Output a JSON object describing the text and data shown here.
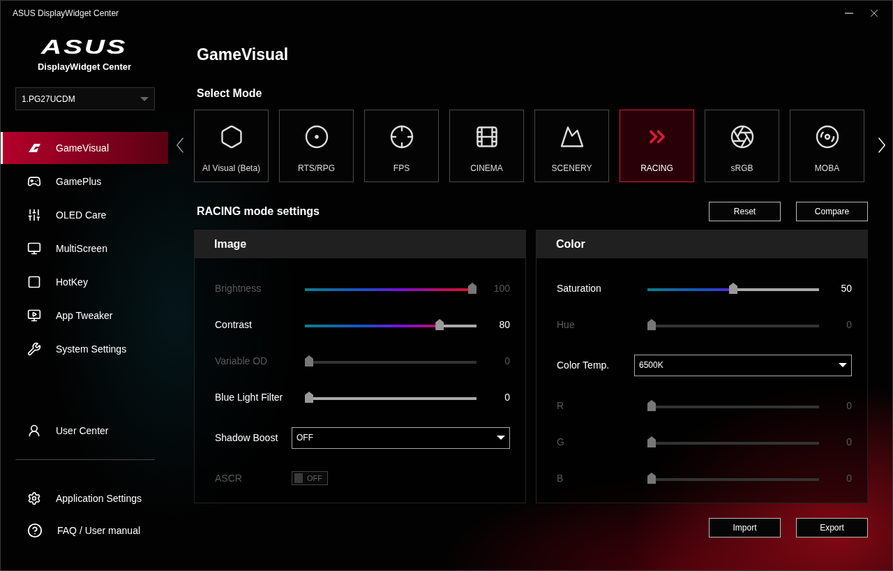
{
  "window": {
    "title": "ASUS DisplayWidget Center"
  },
  "brand": {
    "logo": "ASUS",
    "product": "DisplayWidget Center"
  },
  "monitor_select": {
    "value": "1.PG27UCDM"
  },
  "nav": [
    {
      "label": "GameVisual",
      "selected": true
    },
    {
      "label": "GamePlus",
      "selected": false
    },
    {
      "label": "OLED Care",
      "selected": false
    },
    {
      "label": "MultiScreen",
      "selected": false
    },
    {
      "label": "HotKey",
      "selected": false
    },
    {
      "label": "App Tweaker",
      "selected": false
    },
    {
      "label": "System Settings",
      "selected": false
    }
  ],
  "user_center": {
    "label": "User Center"
  },
  "footer_nav": [
    {
      "label": "Application Settings"
    },
    {
      "label": "FAQ / User manual"
    }
  ],
  "page_title": "GameVisual",
  "mode_heading": "Select Mode",
  "modes": [
    {
      "label": "AI Visual (Beta)",
      "selected": false
    },
    {
      "label": "RTS/RPG",
      "selected": false
    },
    {
      "label": "FPS",
      "selected": false
    },
    {
      "label": "CINEMA",
      "selected": false
    },
    {
      "label": "SCENERY",
      "selected": false
    },
    {
      "label": "RACING",
      "selected": true
    },
    {
      "label": "sRGB",
      "selected": false
    },
    {
      "label": "MOBA",
      "selected": false
    }
  ],
  "settings_title": "RACING mode settings",
  "actions": [
    "Reset",
    "Compare"
  ],
  "panels": [
    {
      "title": "Image",
      "rows": [
        {
          "kind": "slider",
          "label": "Brightness",
          "level": 1,
          "reading": "100",
          "disabled": true
        },
        {
          "kind": "slider",
          "label": "Contrast",
          "level": 0.8,
          "reading": "80",
          "disabled": false
        },
        {
          "kind": "slider",
          "label": "Variable OD",
          "level": 0,
          "reading": "0",
          "disabled": true
        },
        {
          "kind": "slider",
          "label": "Blue Light Filter",
          "level": 0,
          "reading": "0",
          "disabled": false
        },
        {
          "kind": "dropdown",
          "label": "Shadow Boost",
          "value": "OFF"
        },
        {
          "kind": "toggle",
          "label": "ASCR",
          "on": false,
          "disabled": true,
          "state_text": "OFF"
        }
      ]
    },
    {
      "title": "Color",
      "rows": [
        {
          "kind": "slider",
          "label": "Saturation",
          "level": 0.5,
          "reading": "50",
          "disabled": false
        },
        {
          "kind": "slider",
          "label": "Hue",
          "level": 0,
          "reading": "0",
          "disabled": true
        },
        {
          "kind": "dropdown",
          "label": "Color Temp.",
          "value": "6500K"
        },
        {
          "kind": "slider",
          "label": "R",
          "level": 0,
          "reading": "0",
          "disabled": true
        },
        {
          "kind": "slider",
          "label": "G",
          "level": 0,
          "reading": "0",
          "disabled": true
        },
        {
          "kind": "slider",
          "label": "B",
          "level": 0,
          "reading": "0",
          "disabled": true
        }
      ]
    }
  ],
  "bottom_actions": [
    "Import",
    "Export"
  ]
}
